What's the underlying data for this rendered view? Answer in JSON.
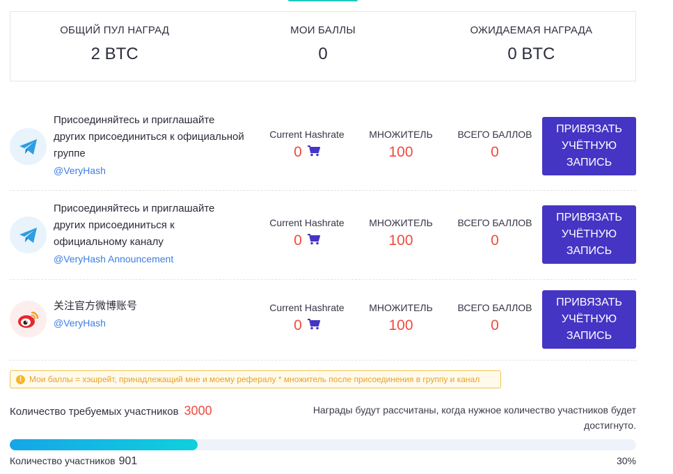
{
  "colors": {
    "accent": "#4535c4",
    "highlight": "#f04a3f",
    "link": "#3e7de2",
    "progress": "#15a6e8",
    "warning": "#e8a12a"
  },
  "stats": [
    {
      "label": "ОБЩИЙ ПУЛ НАГРАД",
      "value": "2 BTC"
    },
    {
      "label": "МОИ БАЛЛЫ",
      "value": "0"
    },
    {
      "label": "ОЖИДАЕМАЯ НАГРАДА",
      "value": "0 BTC"
    }
  ],
  "tasks": [
    {
      "icon": "telegram-icon",
      "title": "Присоединяйтесь и приглашайте других присоединиться к официальной группе",
      "handle": "@VeryHash",
      "hashrate_label": "Current Hashrate",
      "hashrate": "0",
      "multiplier_label": "МНОЖИТЕЛЬ",
      "multiplier": "100",
      "total_label": "ВСЕГО БАЛЛОВ",
      "total": "0",
      "button": "ПРИВЯЗАТЬ УЧЁТНУЮ ЗАПИСЬ"
    },
    {
      "icon": "telegram-icon",
      "title": "Присоединяйтесь и приглашайте других присоединиться к официальному каналу",
      "handle": "@VeryHash Announcement",
      "hashrate_label": "Current Hashrate",
      "hashrate": "0",
      "multiplier_label": "МНОЖИТЕЛЬ",
      "multiplier": "100",
      "total_label": "ВСЕГО БАЛЛОВ",
      "total": "0",
      "button": "ПРИВЯЗАТЬ УЧЁТНУЮ ЗАПИСЬ"
    },
    {
      "icon": "weibo-icon",
      "title": "关注官方微博账号",
      "handle": "@VeryHash",
      "hashrate_label": "Current Hashrate",
      "hashrate": "0",
      "multiplier_label": "МНОЖИТЕЛЬ",
      "multiplier": "100",
      "total_label": "ВСЕГО БАЛЛОВ",
      "total": "0",
      "button": "ПРИВЯЗАТЬ УЧЁТНУЮ ЗАПИСЬ"
    }
  ],
  "note": {
    "icon": "info-icon",
    "text": "Мои баллы = хэшрейт, принадлежащий мне и моему рефералу * множитель после присоединения в группу и канал"
  },
  "requirement": {
    "label": "Количество требуемых участников",
    "value": "3000"
  },
  "reward_note": "Награды будут рассчитаны, когда нужное количество участников будет достигнуто.",
  "progress": {
    "percent_value": 30,
    "percent_label": "30%",
    "participants_label": "Количество участников",
    "participants_value": "901"
  }
}
